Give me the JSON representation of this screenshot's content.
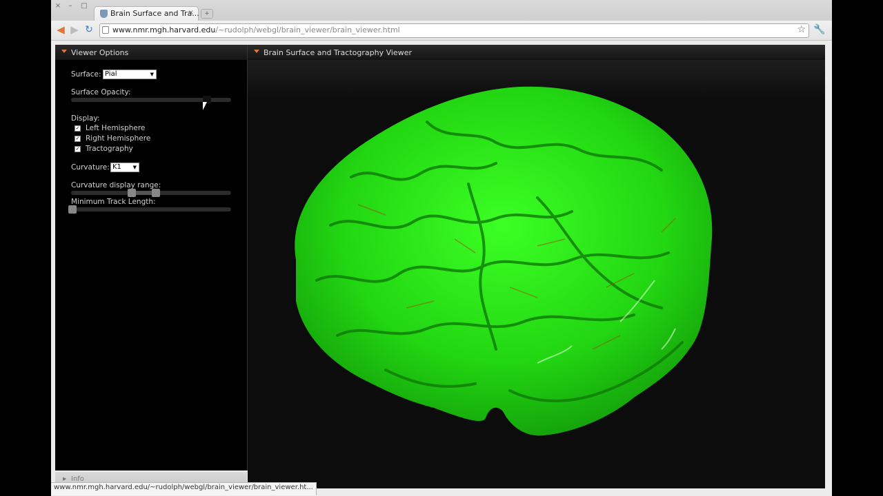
{
  "browser": {
    "tab_title": "Brain Surface and Tra...",
    "tab_close": "×",
    "new_tab": "+",
    "window_buttons": [
      "×",
      "–",
      "□"
    ],
    "url_host": "www.nmr.mgh.harvard.edu",
    "url_path": "/~rudolph/webgl/brain_viewer/brain_viewer.html",
    "status_text": "www.nmr.mgh.harvard.edu/~rudolph/webgl/brain_viewer/brain_viewer.ht..."
  },
  "options_panel": {
    "title": "Viewer Options",
    "surface_label": "Surface:",
    "surface_value": "Pial",
    "opacity_label": "Surface Opacity:",
    "opacity_value": 0.85,
    "display_label": "Display:",
    "display_items": [
      {
        "label": "Left Hemisphere",
        "checked": true
      },
      {
        "label": "Right Hemisphere",
        "checked": true
      },
      {
        "label": "Tractography",
        "checked": true
      }
    ],
    "curvature_label": "Curvature:",
    "curvature_value": "K1",
    "curv_range_label": "Curvature display range:",
    "curv_range_low": 0.38,
    "curv_range_high": 0.53,
    "min_track_label": "Minimum Track Length:",
    "min_track_value": 0.0,
    "info_label": "Info"
  },
  "viewer": {
    "title": "Brain Surface and Tractography Viewer",
    "surface_color": "#2ee61a"
  },
  "colors": {
    "accent": "#e0763a",
    "panel_bg": "#000000"
  }
}
